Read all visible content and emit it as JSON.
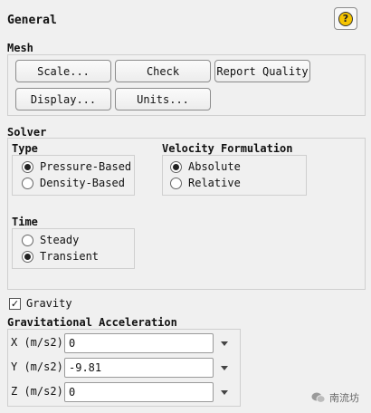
{
  "panel": {
    "title": "General"
  },
  "mesh": {
    "label": "Mesh",
    "buttons": [
      "Scale...",
      "Check",
      "Report Quality",
      "Display...",
      "Units..."
    ]
  },
  "solver": {
    "label": "Solver",
    "type": {
      "label": "Type",
      "options": [
        "Pressure-Based",
        "Density-Based"
      ],
      "selected": "Pressure-Based"
    },
    "velocity": {
      "label": "Velocity Formulation",
      "options": [
        "Absolute",
        "Relative"
      ],
      "selected": "Absolute"
    },
    "time": {
      "label": "Time",
      "options": [
        "Steady",
        "Transient"
      ],
      "selected": "Transient"
    }
  },
  "gravity": {
    "label": "Gravity",
    "checked": true
  },
  "gravitational_acceleration": {
    "label": "Gravitational Acceleration",
    "rows": [
      {
        "label": "X (m/s2)",
        "value": "0"
      },
      {
        "label": "Y (m/s2)",
        "value": "-9.81"
      },
      {
        "label": "Z (m/s2)",
        "value": "0"
      }
    ]
  },
  "watermark": {
    "text": "南流坊"
  },
  "icons": {
    "help": "help-icon",
    "dropdown": "chevron-down-icon",
    "watermark": "wechat-icon"
  }
}
